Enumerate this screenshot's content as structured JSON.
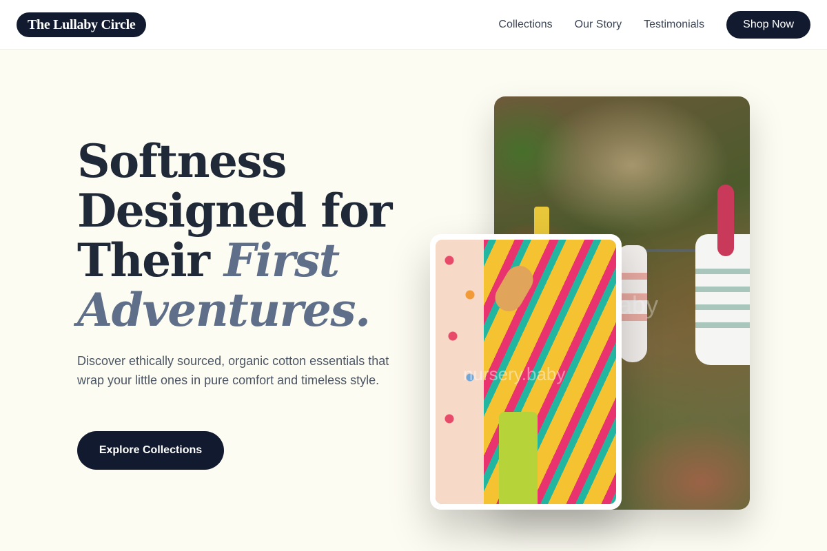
{
  "header": {
    "logo": "The Lullaby Circle",
    "nav": [
      "Collections",
      "Our Story",
      "Testimonials"
    ],
    "shop_button": "Shop Now"
  },
  "hero": {
    "headline_line1": "Softness",
    "headline_line2": "Designed for",
    "headline_line3_plain": "Their",
    "headline_line3_accent": "First",
    "headline_line4_accent": "Adventures.",
    "subtext": "Discover ethically sourced, organic cotton essentials that wrap your little ones in pure comfort and timeless style.",
    "cta": "Explore Collections"
  },
  "images": {
    "back_watermark": "baby",
    "front_watermark": "nursery.baby"
  },
  "colors": {
    "primary_dark": "#111a2e",
    "accent_slate": "#5f6f89",
    "background_cream": "#fdfcf2"
  }
}
